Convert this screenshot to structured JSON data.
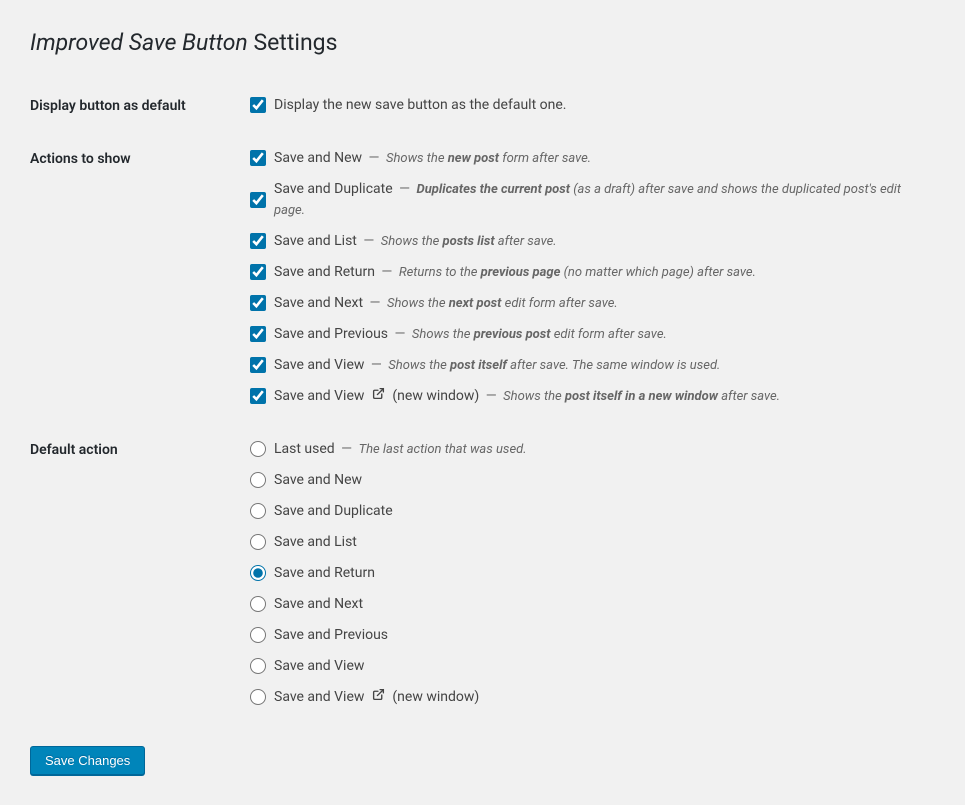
{
  "page": {
    "title_italic": "Improved Save Button",
    "title_rest": " Settings"
  },
  "sections": {
    "display_default": {
      "heading": "Display button as default",
      "checkbox_label": "Display the new save button as the default one.",
      "checked": true
    },
    "actions_to_show": {
      "heading": "Actions to show",
      "items": [
        {
          "label": "Save and New",
          "checked": true,
          "desc_pre": "Shows the ",
          "desc_bold": "new post",
          "desc_post": " form after save.",
          "ext": false
        },
        {
          "label": "Save and Duplicate",
          "checked": true,
          "desc_pre": "",
          "desc_bold": "Duplicates the current post",
          "desc_post": " (as a draft) after save and shows the duplicated post's edit page.",
          "ext": false
        },
        {
          "label": "Save and List",
          "checked": true,
          "desc_pre": "Shows the ",
          "desc_bold": "posts list",
          "desc_post": " after save.",
          "ext": false
        },
        {
          "label": "Save and Return",
          "checked": true,
          "desc_pre": "Returns to the ",
          "desc_bold": "previous page",
          "desc_post": " (no matter which page) after save.",
          "ext": false
        },
        {
          "label": "Save and Next",
          "checked": true,
          "desc_pre": "Shows the ",
          "desc_bold": "next post",
          "desc_post": " edit form after save.",
          "ext": false
        },
        {
          "label": "Save and Previous",
          "checked": true,
          "desc_pre": "Shows the ",
          "desc_bold": "previous post",
          "desc_post": " edit form after save.",
          "ext": false
        },
        {
          "label": "Save and View",
          "checked": true,
          "desc_pre": "Shows the ",
          "desc_bold": "post itself",
          "desc_post": " after save. The same window is used.",
          "ext": false
        },
        {
          "label": "Save and View",
          "checked": true,
          "suffix": "(new window)",
          "desc_pre": "Shows the ",
          "desc_bold": "post itself in a new window",
          "desc_post": " after save.",
          "ext": true
        }
      ]
    },
    "default_action": {
      "heading": "Default action",
      "items": [
        {
          "label": "Last used",
          "selected": false,
          "desc": "The last action that was used.",
          "ext": false
        },
        {
          "label": "Save and New",
          "selected": false,
          "ext": false
        },
        {
          "label": "Save and Duplicate",
          "selected": false,
          "ext": false
        },
        {
          "label": "Save and List",
          "selected": false,
          "ext": false
        },
        {
          "label": "Save and Return",
          "selected": true,
          "ext": false
        },
        {
          "label": "Save and Next",
          "selected": false,
          "ext": false
        },
        {
          "label": "Save and Previous",
          "selected": false,
          "ext": false
        },
        {
          "label": "Save and View",
          "selected": false,
          "ext": false
        },
        {
          "label": "Save and View",
          "selected": false,
          "suffix": "(new window)",
          "ext": true
        }
      ]
    }
  },
  "submit": {
    "label": "Save Changes"
  }
}
